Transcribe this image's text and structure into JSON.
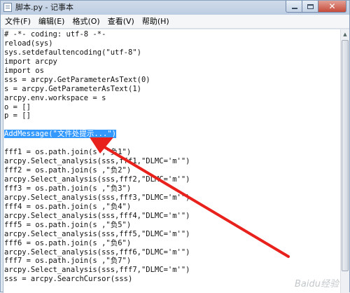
{
  "window": {
    "title": "脚本.py - 记事本",
    "icon": "notepad-icon"
  },
  "menu": [
    {
      "label": "文件(F)"
    },
    {
      "label": "编辑(E)"
    },
    {
      "label": "格式(O)"
    },
    {
      "label": "查看(V)"
    },
    {
      "label": "帮助(H)"
    }
  ],
  "editor": {
    "lines": [
      "# -*- coding: utf-8 -*-",
      "reload(sys)",
      "sys.setdefaultencoding(\"utf-8\")",
      "import arcpy",
      "import os",
      "sss = arcpy.GetParameterAsText(0)",
      "s = arcpy.GetParameterAsText(1)",
      "arcpy.env.workspace = s",
      "o = []",
      "p = []",
      "",
      "AddMessage(\"文件处提示...\")",
      "",
      "fff1 = os.path.join(s ,\"负1\")",
      "arcpy.Select_analysis(sss,fff1,\"DLMC='m'\")",
      "fff2 = os.path.join(s ,\"负2\")",
      "arcpy.Select_analysis(sss,fff2,\"DLMC='m'\")",
      "fff3 = os.path.join(s ,\"负3\")",
      "arcpy.Select_analysis(sss,fff3,\"DLMC='m'\")",
      "fff4 = os.path.join(s ,\"负4\")",
      "arcpy.Select_analysis(sss,fff4,\"DLMC='m'\")",
      "fff5 = os.path.join(s ,\"负5\")",
      "arcpy.Select_analysis(sss,fff5,\"DLMC='m'\")",
      "fff6 = os.path.join(s ,\"负6\")",
      "arcpy.Select_analysis(sss,fff6,\"DLMC='m'\")",
      "fff7 = os.path.join(s ,\"负7\")",
      "arcpy.Select_analysis(sss,fff7,\"DLMC='m'\")",
      "sss = arcpy.SearchCursor(sss)"
    ],
    "selected_line_index": 11,
    "selection_color": "#3399ff"
  },
  "annotation": {
    "arrow_color": "#e8211c"
  },
  "watermark": "Baidu经验"
}
